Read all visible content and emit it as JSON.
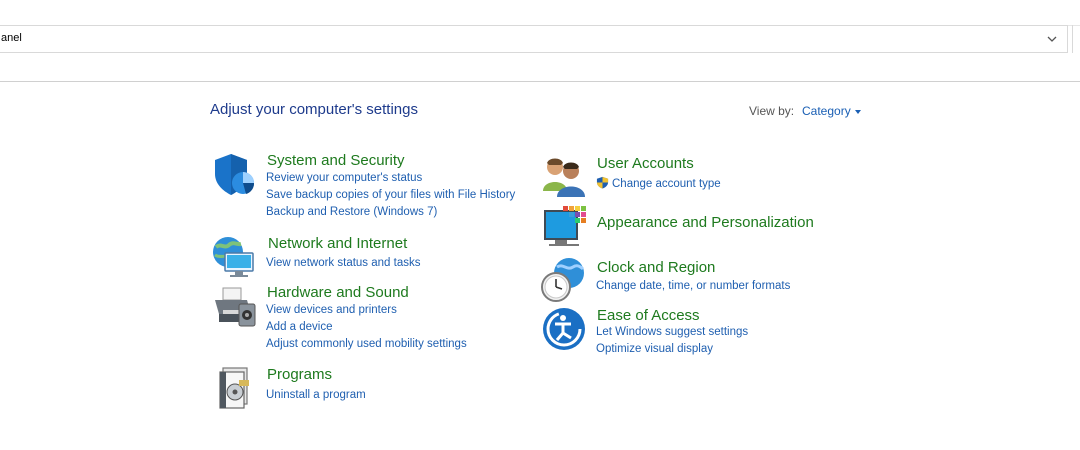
{
  "address": {
    "text": "anel"
  },
  "header": {
    "title": "Adjust your computer's settings",
    "view_by_label": "View by:",
    "view_by_value": "Category"
  },
  "categories": [
    {
      "key": "system",
      "icon": "shield-icon",
      "title": "System and Security",
      "links": [
        "Review your computer's status",
        "Save backup copies of your files with File History",
        "Backup and Restore (Windows 7)"
      ]
    },
    {
      "key": "network",
      "icon": "globe-network-icon",
      "title": "Network and Internet",
      "links": [
        "View network status and tasks"
      ]
    },
    {
      "key": "hardware",
      "icon": "printer-icon",
      "title": "Hardware and Sound",
      "links": [
        "View devices and printers",
        "Add a device",
        "Adjust commonly used mobility settings"
      ]
    },
    {
      "key": "programs",
      "icon": "programs-icon",
      "title": "Programs",
      "links": [
        "Uninstall a program"
      ]
    },
    {
      "key": "users",
      "icon": "users-icon",
      "title": "User Accounts",
      "links": [
        "Change account type"
      ]
    },
    {
      "key": "appearance",
      "icon": "monitor-palette-icon",
      "title": "Appearance and Personalization",
      "links": []
    },
    {
      "key": "clock",
      "icon": "clock-globe-icon",
      "title": "Clock and Region",
      "links": [
        "Change date, time, or number formats"
      ]
    },
    {
      "key": "ease",
      "icon": "ease-of-access-icon",
      "title": "Ease of Access",
      "links": [
        "Let Windows suggest settings",
        "Optimize visual display"
      ]
    }
  ]
}
